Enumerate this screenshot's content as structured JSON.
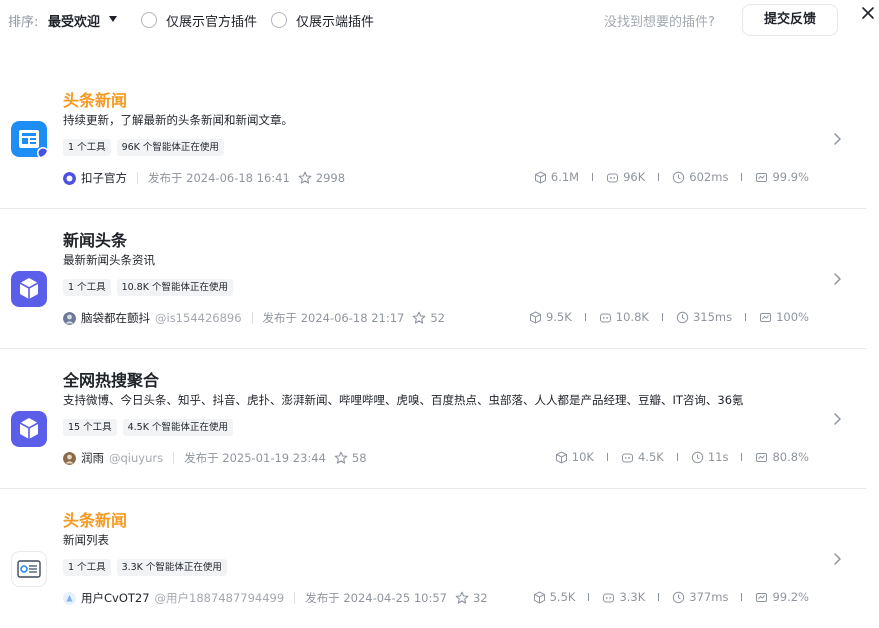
{
  "toolbar": {
    "sort_label": "排序:",
    "sort_value": "最受欢迎",
    "filter_official": "仅展示官方插件",
    "filter_client": "仅展示端插件",
    "hint": "没找到想要的插件?",
    "feedback_button": "提交反馈"
  },
  "plugins": [
    {
      "title": "头条新闻",
      "title_color": "#f59a23",
      "desc": "持续更新，了解最新的头条新闻和新闻文章。",
      "tags": [
        "1 个工具",
        "96K 个智能体正在使用"
      ],
      "author": "扣子官方",
      "handle": "",
      "published": "发布于 2024-06-18 16:41",
      "stars": "2998",
      "stats": [
        "6.1M",
        "96K",
        "602ms",
        "99.9%"
      ],
      "icon": "news-doc-icon"
    },
    {
      "title": "新闻头条",
      "title_color": "#1f2329",
      "desc": "最新新闻头条资讯",
      "tags": [
        "1 个工具",
        "10.8K 个智能体正在使用"
      ],
      "author": "脑袋都在颤抖",
      "handle": "@is154426896",
      "published": "发布于 2024-06-18 21:17",
      "stars": "52",
      "stats": [
        "9.5K",
        "10.8K",
        "315ms",
        "100%"
      ],
      "icon": "cube-icon"
    },
    {
      "title": "全网热搜聚合",
      "title_color": "#1f2329",
      "desc": "支持微博、今日头条、知乎、抖音、虎扑、澎湃新闻、哔哩哔哩、虎嗅、百度热点、虫部落、人人都是产品经理、豆瓣、IT咨询、36氪",
      "tags": [
        "15 个工具",
        "4.5K 个智能体正在使用"
      ],
      "author": "润雨",
      "handle": "@qiuyurs",
      "published": "发布于 2025-01-19 23:44",
      "stars": "58",
      "stats": [
        "10K",
        "4.5K",
        "11s",
        "80.8%"
      ],
      "icon": "cube-icon"
    },
    {
      "title": "头条新闻",
      "title_color": "#f59a23",
      "desc": "新闻列表",
      "tags": [
        "1 个工具",
        "3.3K 个智能体正在使用"
      ],
      "author": "用户CvOT27",
      "handle": "@用户1887487794499",
      "published": "发布于 2024-04-25 10:57",
      "stars": "32",
      "stats": [
        "5.5K",
        "3.3K",
        "377ms",
        "99.2%"
      ],
      "icon": "news-list-icon"
    }
  ]
}
